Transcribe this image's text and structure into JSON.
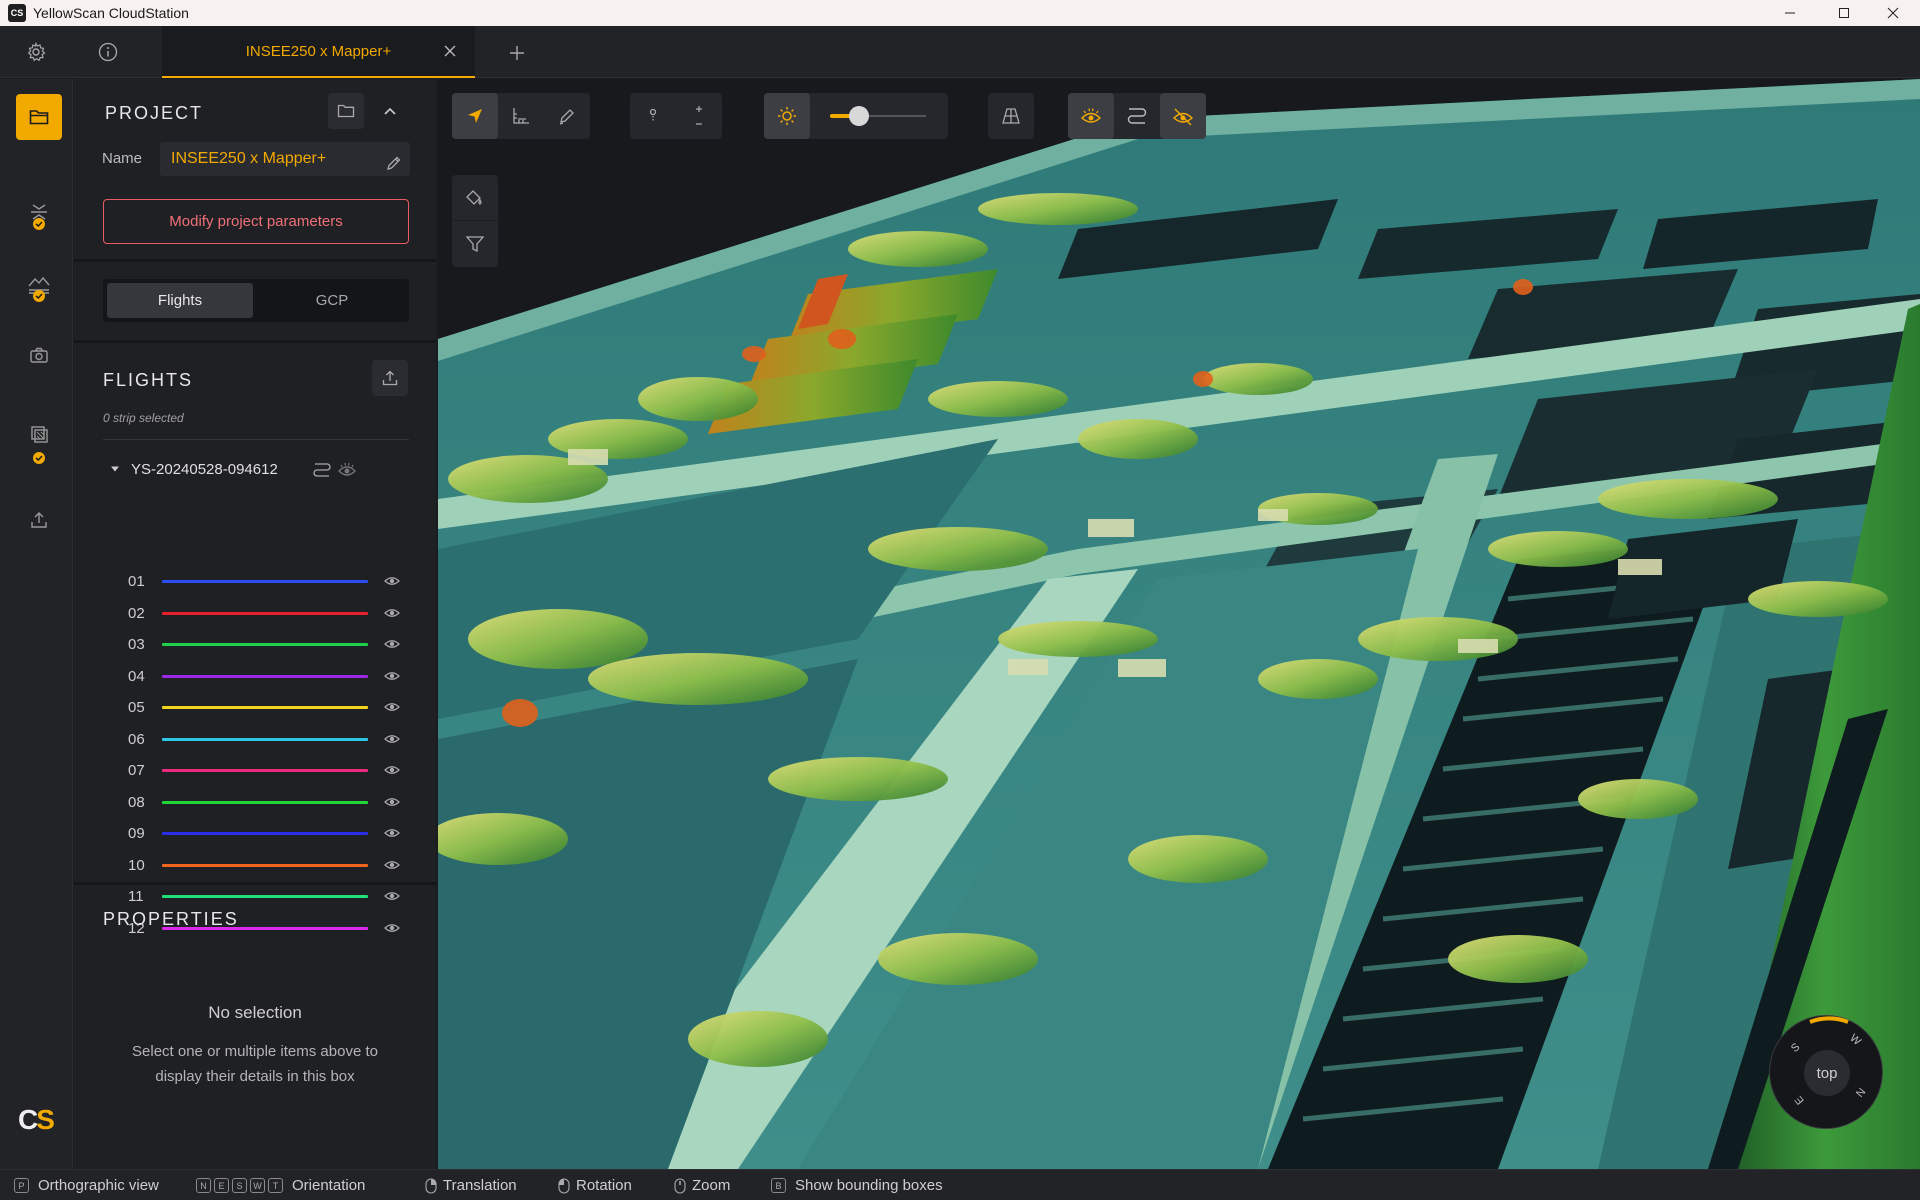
{
  "window": {
    "title": "YellowScan CloudStation",
    "logo_text": "CS"
  },
  "tabs": {
    "active_label": "INSEE250 x Mapper+"
  },
  "colors": {
    "accent": "#f2a900",
    "danger": "#e85a64"
  },
  "project": {
    "section_title": "PROJECT",
    "name_label": "Name",
    "name_value": "INSEE250 x Mapper+",
    "modify_button": "Modify project parameters"
  },
  "segment": {
    "flights_label": "Flights",
    "gcp_label": "GCP"
  },
  "flights": {
    "section_title": "FLIGHTS",
    "selection_status": "0 strip selected",
    "flight_name": "YS-20240528-094612",
    "strips": [
      {
        "num": "01",
        "color": "#2b4cf0"
      },
      {
        "num": "02",
        "color": "#e8202a"
      },
      {
        "num": "03",
        "color": "#1fd04a"
      },
      {
        "num": "04",
        "color": "#9a28e6"
      },
      {
        "num": "05",
        "color": "#f2d21a"
      },
      {
        "num": "06",
        "color": "#2cc6e6"
      },
      {
        "num": "07",
        "color": "#ec2a7e"
      },
      {
        "num": "08",
        "color": "#22d63a"
      },
      {
        "num": "09",
        "color": "#2a2ee8"
      },
      {
        "num": "10",
        "color": "#f0641e"
      },
      {
        "num": "11",
        "color": "#20e07a"
      },
      {
        "num": "12",
        "color": "#d82ae8"
      }
    ]
  },
  "properties": {
    "section_title": "PROPERTIES",
    "empty_title": "No selection",
    "empty_hint": "Select one or multiple items above to display their details in this box"
  },
  "viewer": {
    "point_size_level": 0.3,
    "compass_center": "top",
    "compass_letters": [
      "S",
      "W",
      "N",
      "E"
    ]
  },
  "statusbar": {
    "ortho": {
      "keys": [
        "P"
      ],
      "label": "Orthographic view"
    },
    "orientation": {
      "keys": [
        "N",
        "E",
        "S",
        "W",
        "T"
      ],
      "label": "Orientation"
    },
    "translation": {
      "label": "Translation"
    },
    "rotation": {
      "label": "Rotation"
    },
    "zoom": {
      "label": "Zoom"
    },
    "bbox": {
      "keys": [
        "B"
      ],
      "label": "Show bounding boxes"
    }
  }
}
